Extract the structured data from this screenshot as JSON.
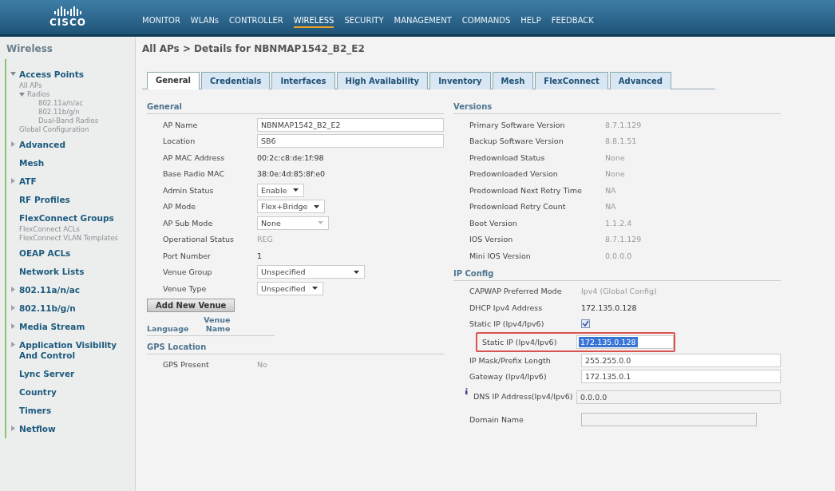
{
  "header": {
    "logo": "CISCO",
    "nav": [
      {
        "label": "MONITOR",
        "selected": false
      },
      {
        "label": "WLANs",
        "selected": false
      },
      {
        "label": "CONTROLLER",
        "selected": false
      },
      {
        "label": "WIRELESS",
        "selected": true
      },
      {
        "label": "SECURITY",
        "selected": false
      },
      {
        "label": "MANAGEMENT",
        "selected": false
      },
      {
        "label": "COMMANDS",
        "selected": false
      },
      {
        "label": "HELP",
        "selected": false
      },
      {
        "label": "FEEDBACK",
        "selected": false
      }
    ]
  },
  "sidebar": {
    "title": "Wireless",
    "items": [
      {
        "label": "Access Points",
        "expanded": true,
        "children": [
          {
            "label": "All APs"
          },
          {
            "label": "Radios",
            "expanded": true,
            "children": [
              {
                "label": "802.11a/n/ac"
              },
              {
                "label": "802.11b/g/n"
              },
              {
                "label": "Dual-Band Radios"
              }
            ]
          },
          {
            "label": "Global Configuration"
          }
        ]
      },
      {
        "label": "Advanced",
        "expanded": false
      },
      {
        "label": "Mesh"
      },
      {
        "label": "ATF",
        "expanded": false
      },
      {
        "label": "RF Profiles"
      },
      {
        "label": "FlexConnect Groups",
        "children": [
          {
            "label": "FlexConnect ACLs"
          },
          {
            "label": "FlexConnect VLAN Templates"
          }
        ]
      },
      {
        "label": "OEAP ACLs"
      },
      {
        "label": "Network Lists"
      },
      {
        "label": "802.11a/n/ac",
        "expanded": false
      },
      {
        "label": "802.11b/g/n",
        "expanded": false
      },
      {
        "label": "Media Stream",
        "expanded": false
      },
      {
        "label": "Application Visibility And Control",
        "expanded": false
      },
      {
        "label": "Lync Server"
      },
      {
        "label": "Country"
      },
      {
        "label": "Timers"
      },
      {
        "label": "Netflow",
        "expanded": false
      }
    ]
  },
  "page_title": "All APs > Details for NBNMAP1542_B2_E2",
  "tabs": [
    {
      "label": "General",
      "selected": true
    },
    {
      "label": "Credentials",
      "selected": false
    },
    {
      "label": "Interfaces",
      "selected": false
    },
    {
      "label": "High Availability",
      "selected": false
    },
    {
      "label": "Inventory",
      "selected": false
    },
    {
      "label": "Mesh",
      "selected": false
    },
    {
      "label": "FlexConnect",
      "selected": false
    },
    {
      "label": "Advanced",
      "selected": false
    }
  ],
  "general": {
    "title": "General",
    "rows": [
      {
        "label": "AP Name",
        "value": "NBNMAP1542_B2_E2",
        "kind": "input"
      },
      {
        "label": "Location",
        "value": "SB6",
        "kind": "input"
      },
      {
        "label": "AP MAC Address",
        "value": "00:2c:c8:de:1f:98",
        "kind": "text"
      },
      {
        "label": "Base Radio MAC",
        "value": "38:0e:4d:85:8f:e0",
        "kind": "text"
      },
      {
        "label": "Admin Status",
        "value": "Enable",
        "kind": "select"
      },
      {
        "label": "AP Mode",
        "value": "Flex+Bridge",
        "kind": "select"
      },
      {
        "label": "AP Sub Mode",
        "value": "None",
        "kind": "select-disabled"
      },
      {
        "label": "Operational Status",
        "value": "REG",
        "kind": "dim"
      },
      {
        "label": "Port Number",
        "value": "1",
        "kind": "text"
      },
      {
        "label": "Venue Group",
        "value": "Unspecified",
        "kind": "select-wide"
      },
      {
        "label": "Venue Type",
        "value": "Unspecified",
        "kind": "select"
      }
    ],
    "add_button": "Add New Venue",
    "venue_columns": [
      "Language",
      "Venue Name"
    ]
  },
  "gps": {
    "title": "GPS Location",
    "rows": [
      {
        "label": "GPS Present",
        "value": "No",
        "kind": "dim"
      }
    ]
  },
  "versions": {
    "title": "Versions",
    "rows": [
      {
        "label": "Primary Software Version",
        "value": "8.7.1.129",
        "kind": "dim"
      },
      {
        "label": "Backup Software Version",
        "value": "8.8.1.51",
        "kind": "dim"
      },
      {
        "label": "Predownload Status",
        "value": "None",
        "kind": "dim"
      },
      {
        "label": "Predownloaded Version",
        "value": "None",
        "kind": "dim"
      },
      {
        "label": "Predownload Next Retry Time",
        "value": "NA",
        "kind": "dim"
      },
      {
        "label": "Predownload Retry Count",
        "value": "NA",
        "kind": "dim"
      },
      {
        "label": "Boot Version",
        "value": "1.1.2.4",
        "kind": "dim"
      },
      {
        "label": "IOS Version",
        "value": "8.7.1.129",
        "kind": "dim"
      },
      {
        "label": "Mini IOS Version",
        "value": "0.0.0.0",
        "kind": "dim"
      }
    ]
  },
  "ip_config": {
    "title": "IP Config",
    "rows": [
      {
        "label": "CAPWAP Preferred Mode",
        "value": "Ipv4 (Global Config)",
        "kind": "dim"
      },
      {
        "label": "DHCP Ipv4 Address",
        "value": "172.135.0.128",
        "kind": "text"
      },
      {
        "label": "Static IP (Ipv4/Ipv6)",
        "checked": true,
        "kind": "checkbox"
      },
      {
        "label": "Static IP (Ipv4/Ipv6)",
        "value": "172.135.0.128",
        "kind": "input-highlight"
      },
      {
        "label": "IP Mask/Prefix Length",
        "value": "255.255.0.0",
        "kind": "input"
      },
      {
        "label": "Gateway (Ipv4/Ipv6)",
        "value": "172.135.0.1",
        "kind": "input"
      },
      {
        "label": "DNS IP Address(Ipv4/Ipv6)",
        "value": "0.0.0.0",
        "kind": "info-disabled"
      },
      {
        "label": "Domain Name",
        "kind": "disabled-short"
      }
    ]
  }
}
